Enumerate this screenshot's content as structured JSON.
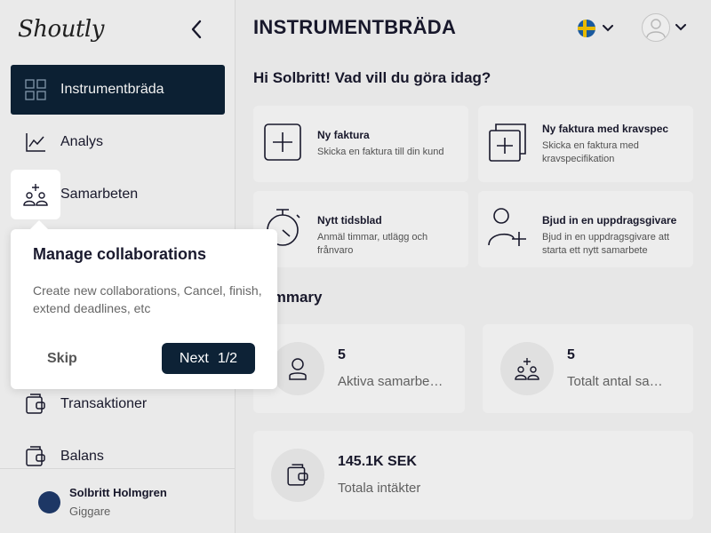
{
  "app": {
    "logo": "Shoutly"
  },
  "sidebar": {
    "items": [
      {
        "label": "Instrumentbräda",
        "icon": "grid-icon"
      },
      {
        "label": "Analys",
        "icon": "chart-icon"
      },
      {
        "label": "Samarbeten",
        "icon": "collaboration-icon"
      },
      {
        "label": "Transaktioner",
        "icon": "wallet-icon"
      },
      {
        "label": "Balans",
        "icon": "wallet-icon"
      }
    ],
    "user": {
      "name": "Solbritt Holmgren",
      "role": "Giggare"
    }
  },
  "header": {
    "title": "INSTRUMENTBRÄDA",
    "language_flag": "sweden-flag-icon"
  },
  "greeting": "Hi Solbritt! Vad vill du göra idag?",
  "actions": [
    {
      "title": "Ny faktura",
      "desc": "Skicka en faktura till din kund"
    },
    {
      "title": "Ny faktura med kravspec",
      "desc": "Skicka en faktura med kravspecifikation"
    },
    {
      "title": "Nytt tidsblad",
      "desc": "Anmäl timmar, utlägg och frånvaro"
    },
    {
      "title": "Bjud in en uppdragsgivare",
      "desc": "Bjud in en uppdragsgivare att starta ett nytt samarbete"
    }
  ],
  "summary": {
    "title": "Summary",
    "stats": [
      {
        "value": "5",
        "label": "Aktiva samarbeten"
      },
      {
        "value": "5",
        "label": "Totalt antal samarbeten"
      },
      {
        "value": "145.1K SEK",
        "label": "Totala intäkter"
      }
    ]
  },
  "tour": {
    "title": "Manage collaborations",
    "body": "Create new collaborations, Cancel, finish, extend deadlines, etc",
    "skip_label": "Skip",
    "next_label": "Next",
    "step": "1/2"
  },
  "colors": {
    "primary": "#0d2236",
    "background": "#f4f4f4",
    "card": "#fafafa"
  }
}
